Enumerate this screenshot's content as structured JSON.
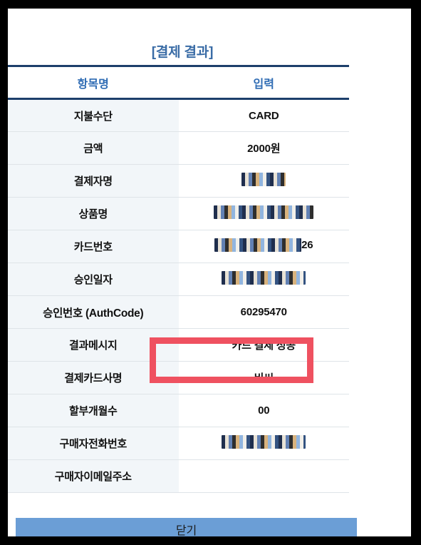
{
  "dialog": {
    "title": "[결제 결과]",
    "close_label": "닫기"
  },
  "table": {
    "headers": {
      "label": "항목명",
      "value": "입력"
    },
    "rows": [
      {
        "label": "지불수단",
        "value": "CARD",
        "redacted": false
      },
      {
        "label": "금액",
        "value": "2000원",
        "redacted": false
      },
      {
        "label": "결제자명",
        "value": "",
        "redacted": true
      },
      {
        "label": "상품명",
        "value": "",
        "redacted": true
      },
      {
        "label": "카드번호",
        "value": "26",
        "redacted": true
      },
      {
        "label": "승인일자",
        "value": "",
        "redacted": true
      },
      {
        "label": "승인번호 (AuthCode)",
        "value": "60295470",
        "redacted": false
      },
      {
        "label": "결과메시지",
        "value": "카드 결제 성공",
        "redacted": false
      },
      {
        "label": "결제카드사명",
        "value": "비씨",
        "redacted": false
      },
      {
        "label": "할부개월수",
        "value": "00",
        "redacted": false
      },
      {
        "label": "구매자전화번호",
        "value": "",
        "redacted": true
      },
      {
        "label": "구매자이메일주소",
        "value": "",
        "redacted": false
      }
    ]
  },
  "colors": {
    "title": "#3A6CA6",
    "header_text": "#2F6CB4",
    "header_rule": "#1D3F6B",
    "label_bg": "#F2F6F9",
    "highlight": "#EF5160",
    "button_bg": "#6B9ED6",
    "frame": "#000000"
  }
}
